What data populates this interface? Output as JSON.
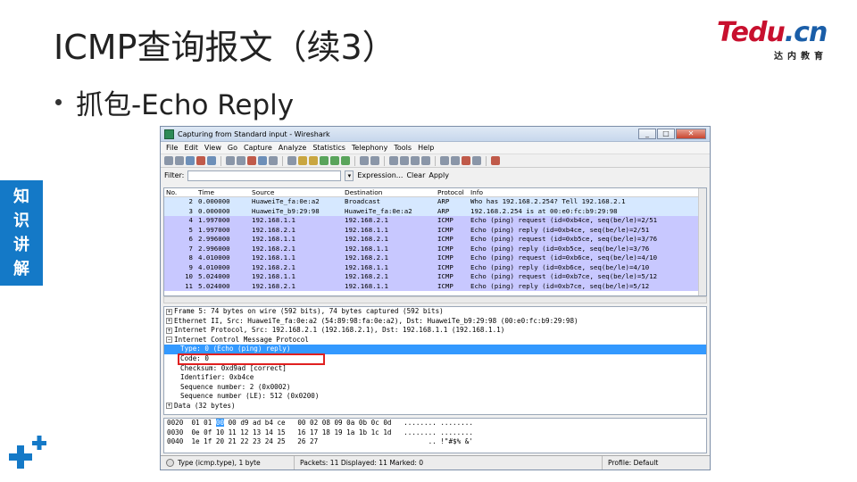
{
  "slide": {
    "title": "ICMP查询报文（续3）",
    "bullet": "抓包-Echo Reply",
    "side_tab": [
      "知",
      "识",
      "讲",
      "解"
    ],
    "logo_main": "Tedu",
    "logo_cn": ".cn",
    "logo_sub": "达内教育"
  },
  "wireshark": {
    "title": "Capturing from Standard input - Wireshark",
    "menu": [
      "File",
      "Edit",
      "View",
      "Go",
      "Capture",
      "Analyze",
      "Statistics",
      "Telephony",
      "Tools",
      "Help"
    ],
    "filter_label": "Filter:",
    "filter_value": "",
    "expression": "Expression...",
    "clear": "Clear",
    "apply": "Apply",
    "columns": [
      "No.",
      "Time",
      "Source",
      "Destination",
      "Protocol",
      "Info"
    ],
    "packets": [
      {
        "no": "2",
        "time": "0.000000",
        "src": "HuaweiTe_fa:0e:a2",
        "dst": "Broadcast",
        "proto": "ARP",
        "info": "Who has 192.168.2.254?  Tell 192.168.2.1"
      },
      {
        "no": "3",
        "time": "0.000000",
        "src": "HuaweiTe_b9:29:98",
        "dst": "HuaweiTe_fa:0e:a2",
        "proto": "ARP",
        "info": "192.168.2.254 is at 00:e0:fc:b9:29:98"
      },
      {
        "no": "4",
        "time": "1.997000",
        "src": "192.168.1.1",
        "dst": "192.168.2.1",
        "proto": "ICMP",
        "info": "Echo (ping) request  (id=0xb4ce, seq(be/le)=2/51"
      },
      {
        "no": "5",
        "time": "1.997000",
        "src": "192.168.2.1",
        "dst": "192.168.1.1",
        "proto": "ICMP",
        "info": "Echo (ping) reply    (id=0xb4ce, seq(be/le)=2/51"
      },
      {
        "no": "6",
        "time": "2.996000",
        "src": "192.168.1.1",
        "dst": "192.168.2.1",
        "proto": "ICMP",
        "info": "Echo (ping) request  (id=0xb5ce, seq(be/le)=3/76"
      },
      {
        "no": "7",
        "time": "2.996000",
        "src": "192.168.2.1",
        "dst": "192.168.1.1",
        "proto": "ICMP",
        "info": "Echo (ping) reply    (id=0xb5ce, seq(be/le)=3/76"
      },
      {
        "no": "8",
        "time": "4.010000",
        "src": "192.168.1.1",
        "dst": "192.168.2.1",
        "proto": "ICMP",
        "info": "Echo (ping) request  (id=0xb6ce, seq(be/le)=4/10"
      },
      {
        "no": "9",
        "time": "4.010000",
        "src": "192.168.2.1",
        "dst": "192.168.1.1",
        "proto": "ICMP",
        "info": "Echo (ping) reply    (id=0xb6ce, seq(be/le)=4/10"
      },
      {
        "no": "10",
        "time": "5.024000",
        "src": "192.168.1.1",
        "dst": "192.168.2.1",
        "proto": "ICMP",
        "info": "Echo (ping) request  (id=0xb7ce, seq(be/le)=5/12"
      },
      {
        "no": "11",
        "time": "5.024000",
        "src": "192.168.2.1",
        "dst": "192.168.1.1",
        "proto": "ICMP",
        "info": "Echo (ping) reply    (id=0xb7ce, seq(be/le)=5/12"
      }
    ],
    "details": [
      {
        "exp": "+",
        "indent": 0,
        "text": "Frame 5: 74 bytes on wire (592 bits), 74 bytes captured (592 bits)"
      },
      {
        "exp": "+",
        "indent": 0,
        "text": "Ethernet II, Src: HuaweiTe_fa:0e:a2 (54:89:98:fa:0e:a2), Dst: HuaweiTe_b9:29:98 (00:e0:fc:b9:29:98)"
      },
      {
        "exp": "+",
        "indent": 0,
        "text": "Internet Protocol, Src: 192.168.2.1 (192.168.2.1), Dst: 192.168.1.1 (192.168.1.1)"
      },
      {
        "exp": "-",
        "indent": 0,
        "text": "Internet Control Message Protocol"
      },
      {
        "exp": "",
        "indent": 1,
        "text": "Type: 0 (Echo (ping) reply)"
      },
      {
        "exp": "",
        "indent": 1,
        "text": "Code: 0"
      },
      {
        "exp": "",
        "indent": 1,
        "text": "Checksum: 0xd9ad [correct]"
      },
      {
        "exp": "",
        "indent": 1,
        "text": "Identifier: 0xb4ce"
      },
      {
        "exp": "",
        "indent": 1,
        "text": "Sequence number: 2 (0x0002)"
      },
      {
        "exp": "",
        "indent": 1,
        "text": "Sequence number (LE): 512 (0x0200)"
      },
      {
        "exp": "+",
        "indent": 0,
        "text": "Data (32 bytes)"
      }
    ],
    "hex": [
      {
        "off": "0020",
        "pre": "  01 01 ",
        "sel": "00",
        "post": " 00 d9 ad b4 ce   00 02 08 09 0a 0b 0c 0d",
        "ascii": "   ........ ........"
      },
      {
        "off": "0030",
        "pre": "  0e 0f 10 11 12 13 14 15   16 17 18 19 1a 1b 1c 1d",
        "sel": "",
        "post": "",
        "ascii": "   ........ ........"
      },
      {
        "off": "0040",
        "pre": "  1e 1f 20 21 22 23 24 25   26 27",
        "sel": "",
        "post": "",
        "ascii": "                           .. !\"#$% &'"
      }
    ],
    "status_field": "Type (icmp.type), 1 byte",
    "status_packets": "Packets: 11 Displayed: 11 Marked: 0",
    "status_profile": "Profile: Default",
    "selected_row": 3,
    "colors": {
      "arp": "#d6e8ff",
      "icmp": "#c8c8ff",
      "highlight": "#3399ff",
      "redbox": "#e02020"
    }
  }
}
